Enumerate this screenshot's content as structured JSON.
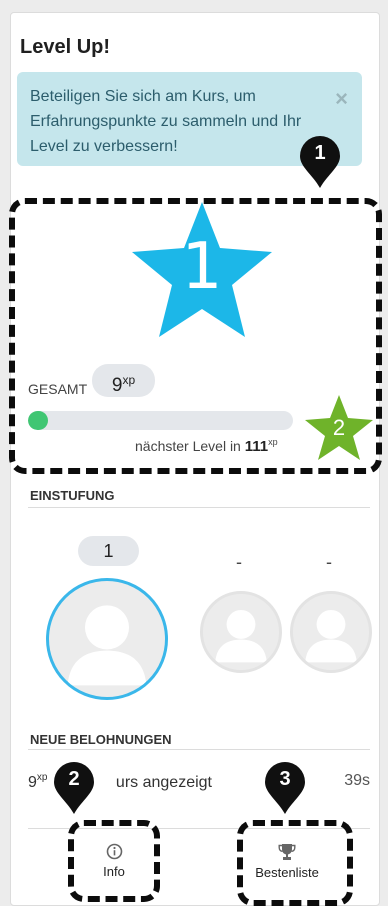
{
  "block": {
    "title": "Level Up!",
    "alert": {
      "text": "Beteiligen Sie sich am Kurs, um Erfahrungspunkte zu sammeln und Ihr Level zu verbessern!",
      "close_icon": "×"
    }
  },
  "level": {
    "current": "1",
    "total_label": "GESAMT",
    "total_value": "9",
    "xp_unit": "xp",
    "progress_fraction": 0.075,
    "next_level_label": "nächster Level in",
    "next_level_value": "111",
    "next_level_star": "2"
  },
  "ranking": {
    "heading": "EINSTUFUNG",
    "entries": [
      {
        "rank": "1"
      },
      {
        "rank": "-"
      },
      {
        "rank": "-"
      }
    ]
  },
  "rewards": {
    "heading": "NEUE BELOHNUNGEN",
    "items": [
      {
        "xp": "9",
        "xp_unit": "xp",
        "text": "Kurs angezeigt",
        "visible_text": "urs angezeigt",
        "time": "39s"
      }
    ]
  },
  "footer": {
    "info_label": "Info",
    "leaderboard_label": "Bestenliste"
  },
  "markers": [
    "1",
    "2",
    "3"
  ],
  "colors": {
    "alert_bg": "#c5e6ec",
    "alert_text": "#2c5d6c",
    "level_star": "#1cb7e8",
    "next_star": "#6fb32a",
    "progress_fill": "#40c673",
    "avatar_ring": "#3ab7ea"
  },
  "icons": {
    "level_star": "star-icon",
    "info": "info-circle-icon",
    "leaderboard": "trophy-icon"
  }
}
